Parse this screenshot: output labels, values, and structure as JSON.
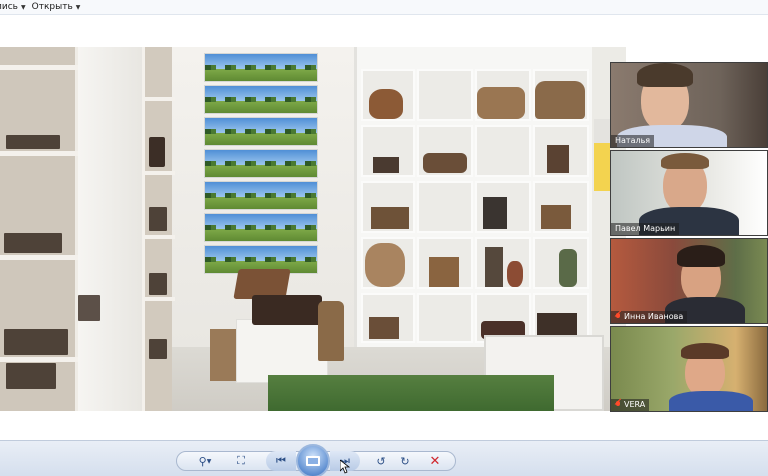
{
  "menubar": {
    "items": [
      {
        "label": "пись",
        "has_caret": true
      },
      {
        "label": "Открыть",
        "has_caret": true
      }
    ]
  },
  "participants": [
    {
      "name": "Наталья",
      "muted": false
    },
    {
      "name": "Павел Марьин",
      "muted": false
    },
    {
      "name": "Инна Иванова",
      "muted": true
    },
    {
      "name": "VERA",
      "muted": true
    }
  ],
  "toolbar": {
    "buttons": [
      {
        "name": "zoom-button",
        "icon": "magnifier-icon"
      },
      {
        "name": "fit-button",
        "icon": "fit-window-icon"
      },
      {
        "name": "previous-button",
        "icon": "previous-icon"
      },
      {
        "name": "slideshow-button",
        "icon": "slideshow-icon"
      },
      {
        "name": "next-button",
        "icon": "next-icon"
      },
      {
        "name": "rotate-left-button",
        "icon": "rotate-ccw-icon"
      },
      {
        "name": "rotate-right-button",
        "icon": "rotate-cw-icon"
      },
      {
        "name": "delete-button",
        "icon": "delete-x-icon"
      }
    ]
  },
  "colors": {
    "mute_icon": "#ff4a2a",
    "delete_icon": "#d0262d",
    "toolbar_accent": "#2c4f86"
  }
}
